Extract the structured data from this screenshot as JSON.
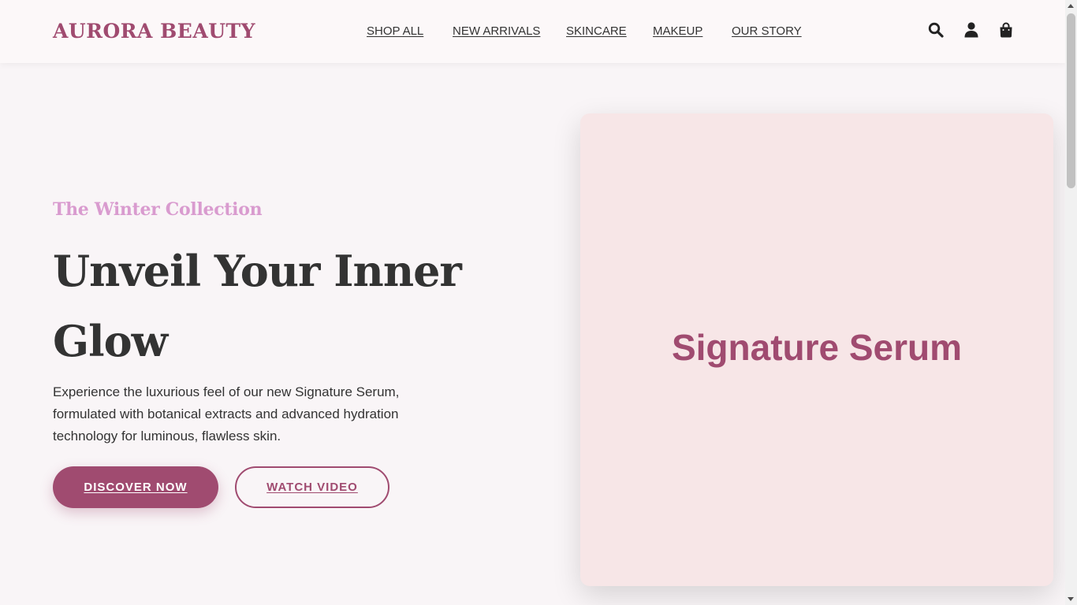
{
  "header": {
    "logo": "AURORA BEAUTY",
    "nav": [
      {
        "label": "SHOP ALL"
      },
      {
        "label": "NEW ARRIVALS"
      },
      {
        "label": "SKINCARE"
      },
      {
        "label": "MAKEUP"
      },
      {
        "label": "OUR STORY"
      }
    ],
    "icons": [
      "search-icon",
      "user-icon",
      "shopping-bag-icon"
    ]
  },
  "hero": {
    "eyebrow": "The Winter Collection",
    "headline": "Unveil Your Inner Glow",
    "description": "Experience the luxurious feel of our new Signature Serum, formulated with botanical extracts and advanced hydration technology for luminous, flawless skin.",
    "primary_cta": "DISCOVER NOW",
    "secondary_cta": "WATCH VIDEO"
  },
  "product_card": {
    "title": "Signature Serum"
  },
  "colors": {
    "brand": "#a04b70",
    "eyebrow": "#d99bcf",
    "page_bg": "#f9f5f7",
    "card_bg": "#f7e6e7",
    "text": "#333333"
  }
}
